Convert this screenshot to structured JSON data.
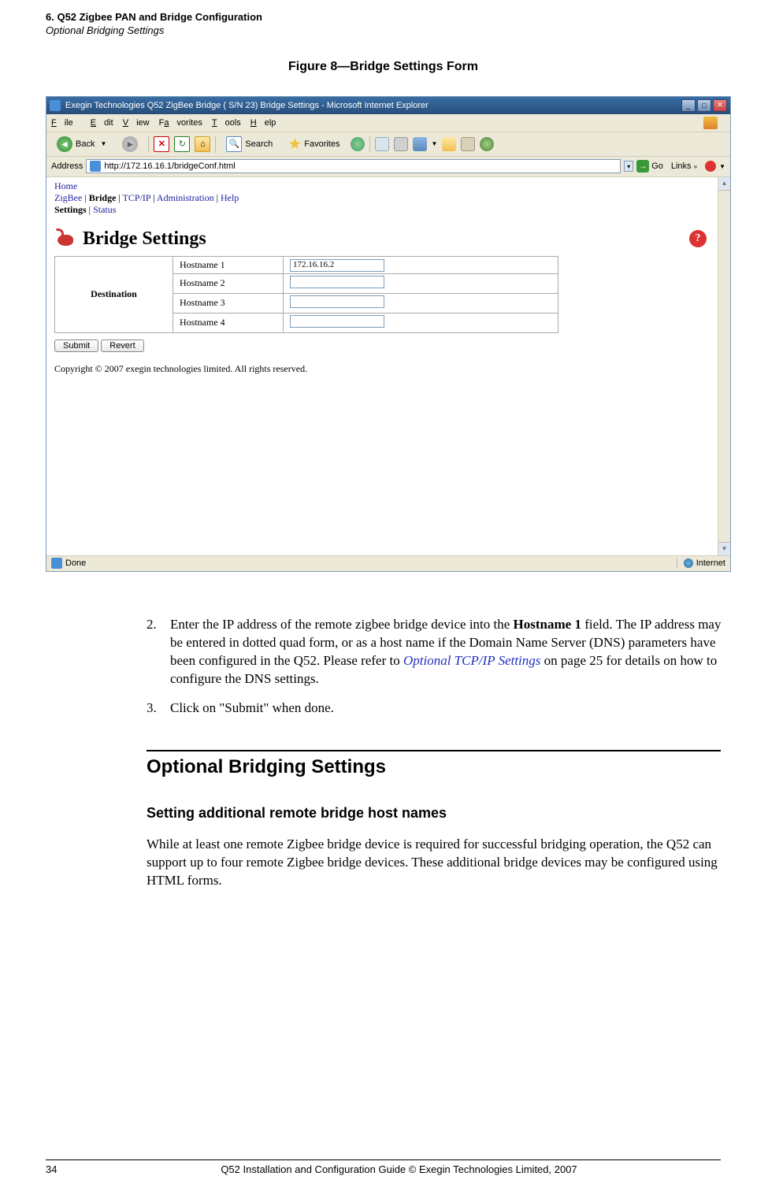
{
  "header": {
    "line1": "6. Q52 Zigbee PAN and Bridge Configuration",
    "line2": "Optional Bridging Settings"
  },
  "figure_title": "Figure 8—Bridge Settings Form",
  "browser": {
    "title": "Exegin Technologies Q52 ZigBee Bridge ( S/N 23) Bridge Settings - Microsoft Internet Explorer",
    "menu": {
      "file": "File",
      "edit": "Edit",
      "view": "View",
      "favorites": "Favorites",
      "tools": "Tools",
      "help": "Help"
    },
    "toolbar": {
      "back": "Back",
      "search": "Search",
      "favorites": "Favorites"
    },
    "address_label": "Address",
    "address_url": "http://172.16.16.1/bridgeConf.html",
    "go_label": "Go",
    "links_label": "Links",
    "nav": {
      "home": "Home",
      "zigbee": "ZigBee",
      "bridge": "Bridge",
      "tcpip": "TCP/IP",
      "admin": "Administration",
      "help": "Help",
      "settings": "Settings",
      "status": "Status"
    },
    "page_title": "Bridge Settings",
    "help_icon": "?",
    "destination_label": "Destination",
    "hosts": [
      {
        "label": "Hostname 1",
        "value": "172.16.16.2"
      },
      {
        "label": "Hostname 2",
        "value": ""
      },
      {
        "label": "Hostname 3",
        "value": ""
      },
      {
        "label": "Hostname 4",
        "value": ""
      }
    ],
    "buttons": {
      "submit": "Submit",
      "revert": "Revert"
    },
    "copyright": "Copyright © 2007 exegin technologies limited. All rights reserved.",
    "status_done": "Done",
    "status_zone": "Internet"
  },
  "steps": {
    "s2num": "2.",
    "s2a": "Enter the IP address of the remote zigbee bridge device into the ",
    "s2b": "Hostname 1",
    "s2c": " field. The IP address may be entered in dotted quad form, or as a host name if the Domain Name Server (DNS) parameters have been configured in the Q52. Please refer to ",
    "s2d": "Optional TCP/IP Settings",
    "s2e": " on page 25 for details on how to configure the DNS settings.",
    "s3num": "3.",
    "s3": "Click on \"Submit\" when done."
  },
  "section": {
    "h2": "Optional Bridging Settings",
    "h3": "Setting additional remote bridge host names",
    "para": "While at least one remote Zigbee bridge device is required for successful bridging operation, the Q52 can support up to four remote Zigbee bridge devices. These additional bridge devices may be configured using HTML forms."
  },
  "footer": {
    "page": "34",
    "text": "Q52 Installation and Configuration Guide  © Exegin Technologies Limited, 2007"
  }
}
